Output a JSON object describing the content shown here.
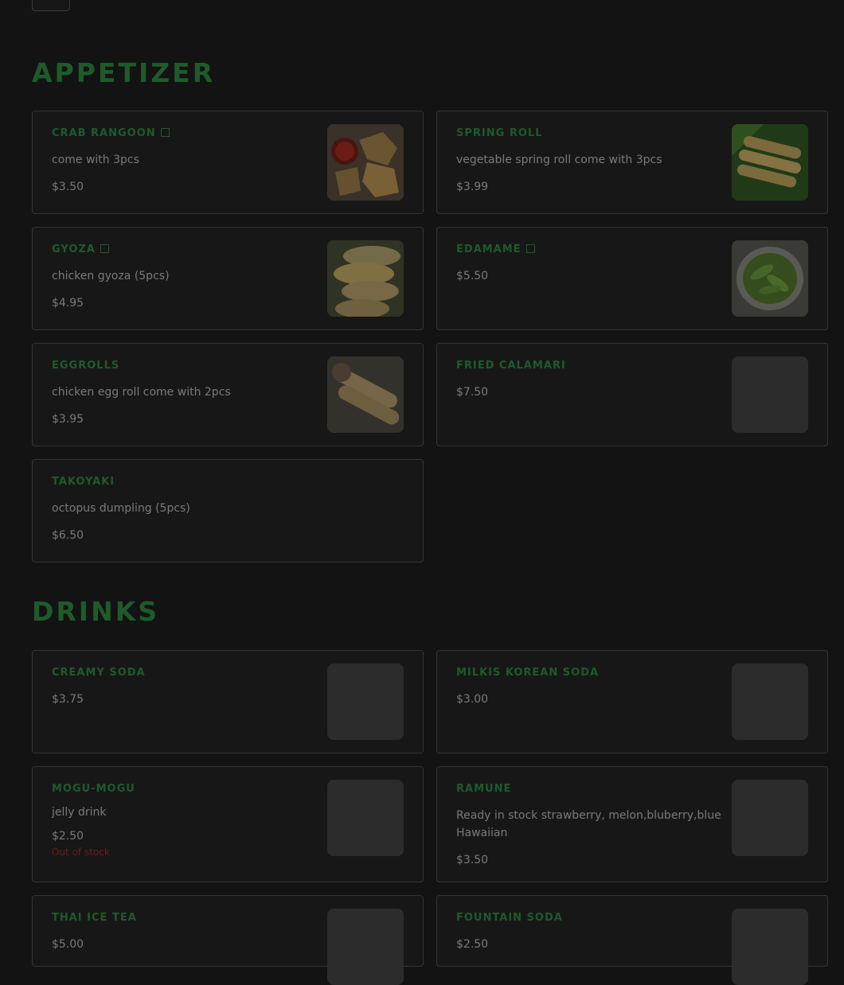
{
  "sections": [
    {
      "title": "Appetizer",
      "items": [
        {
          "name": "Crab Rangoon",
          "badge": true,
          "desc": "come with 3pcs",
          "price": "$3.50",
          "image": "crab-rangoon-photo"
        },
        {
          "name": "Spring Roll",
          "badge": false,
          "desc": "vegetable spring roll come with 3pcs",
          "price": "$3.99",
          "image": "spring-roll-photo"
        },
        {
          "name": "Gyoza",
          "badge": true,
          "desc": "chicken gyoza (5pcs)",
          "price": "$4.95",
          "image": "gyoza-photo"
        },
        {
          "name": "Edamame",
          "badge": true,
          "desc": "",
          "price": "$5.50",
          "image": "edamame-photo"
        },
        {
          "name": "Eggrolls",
          "badge": false,
          "desc": "chicken egg roll come with 2pcs",
          "price": "$3.95",
          "image": "eggroll-photo"
        },
        {
          "name": "Fried Calamari",
          "badge": false,
          "desc": "",
          "price": "$7.50",
          "image": "placeholder"
        },
        {
          "name": "Takoyaki",
          "badge": false,
          "desc": "octopus dumpling (5pcs)",
          "price": "$6.50",
          "image": ""
        }
      ]
    },
    {
      "title": "Drinks",
      "items": [
        {
          "name": "Creamy Soda",
          "desc": "",
          "price": "$3.75",
          "image": "placeholder"
        },
        {
          "name": "Milkis Korean Soda",
          "desc": "",
          "price": "$3.00",
          "image": "placeholder"
        },
        {
          "name": "Mogu-Mogu",
          "desc": "jelly drink",
          "price": "$2.50",
          "stock": "Out of stock",
          "image": "placeholder"
        },
        {
          "name": "Ramune",
          "desc": "Ready in stock strawberry, melon,bluberry,blue Hawaiian",
          "price": "$3.50",
          "image": "placeholder"
        },
        {
          "name": "Thai Ice Tea",
          "desc": "",
          "price": "$5.00",
          "image": "placeholder"
        },
        {
          "name": "Fountain Soda",
          "desc": "",
          "price": "$2.50",
          "image": "placeholder"
        }
      ]
    }
  ],
  "colors": {
    "background": "#131313",
    "card": "#171717",
    "accent_green": "#1f5a2b",
    "text_muted": "#7a7a7a",
    "out_of_stock": "#6a1d1d"
  }
}
